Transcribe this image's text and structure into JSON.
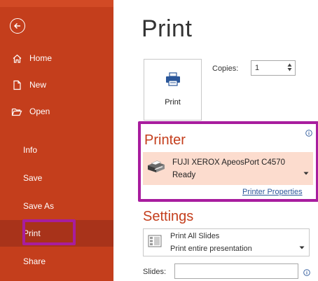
{
  "sidebar": {
    "home": "Home",
    "new": "New",
    "open": "Open",
    "info": "Info",
    "save": "Save",
    "save_as": "Save As",
    "print": "Print",
    "share": "Share"
  },
  "main": {
    "title": "Print",
    "print_button": "Print",
    "copies_label": "Copies:",
    "copies_value": "1",
    "printer_heading": "Printer",
    "printer_name": "FUJI XEROX ApeosPort C4570",
    "printer_status": "Ready",
    "printer_properties": "Printer Properties",
    "settings_heading": "Settings",
    "slides_option_title": "Print All Slides",
    "slides_option_desc": "Print entire presentation",
    "slides_label": "Slides:",
    "slides_value": ""
  },
  "colors": {
    "accent": "#c43e1c",
    "highlight": "#a81d9e",
    "link": "#2b579a"
  }
}
